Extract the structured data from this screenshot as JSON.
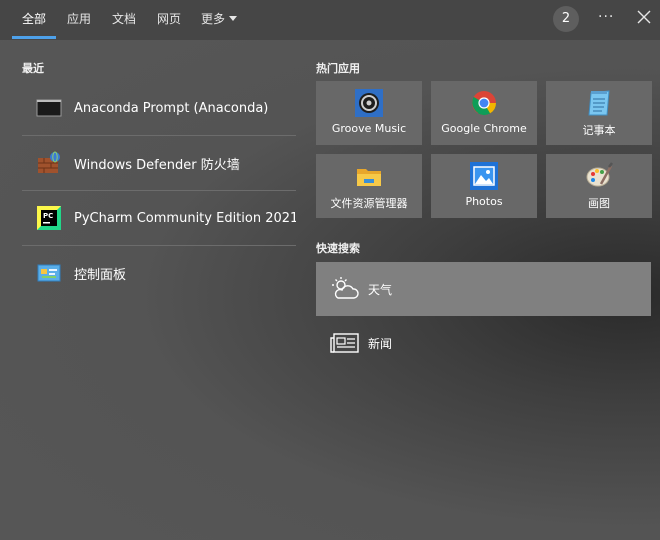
{
  "tabs": [
    {
      "label": "全部",
      "active": true
    },
    {
      "label": "应用"
    },
    {
      "label": "文档"
    },
    {
      "label": "网页"
    },
    {
      "label": "更多"
    }
  ],
  "header": {
    "badge": "2",
    "more": "···"
  },
  "recent": {
    "title": "最近",
    "items": [
      {
        "label": "Anaconda Prompt (Anaconda)",
        "icon": "terminal-icon"
      },
      {
        "label": "Windows Defender 防火墙",
        "icon": "firewall-icon"
      },
      {
        "label": "PyCharm Community Edition 2021...",
        "icon": "pycharm-icon"
      },
      {
        "label": "控制面板",
        "icon": "control-panel-icon"
      }
    ]
  },
  "top_apps": {
    "title": "热门应用",
    "items": [
      {
        "label": "Groove Music",
        "icon": "groove-music-icon"
      },
      {
        "label": "Google Chrome",
        "icon": "chrome-icon"
      },
      {
        "label": "记事本",
        "icon": "notepad-icon"
      },
      {
        "label": "文件资源管理器",
        "icon": "file-explorer-icon"
      },
      {
        "label": "Photos",
        "icon": "photos-icon"
      },
      {
        "label": "画图",
        "icon": "paint-icon"
      }
    ]
  },
  "quick_search": {
    "title": "快速搜索",
    "items": [
      {
        "label": "天气",
        "icon": "weather-icon"
      },
      {
        "label": "新闻",
        "icon": "news-icon"
      }
    ]
  },
  "colors": {
    "accent": "#4ea1ea",
    "tile": "#686868",
    "highlight": "#808080"
  }
}
